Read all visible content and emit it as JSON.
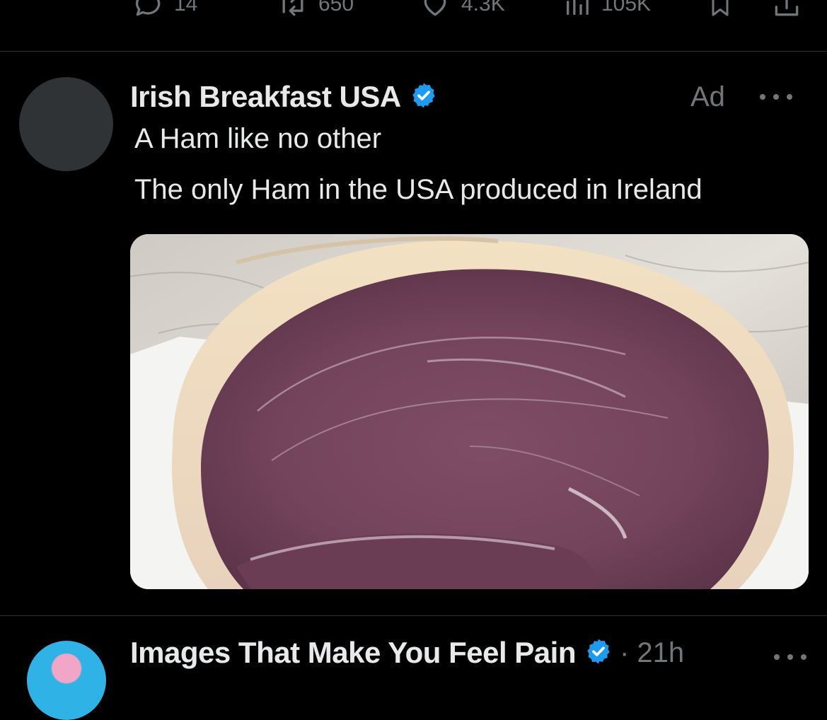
{
  "previous_tweet": {
    "actions": [
      {
        "name": "reply",
        "icon": "reply-icon",
        "count": "14"
      },
      {
        "name": "repost",
        "icon": "repost-icon",
        "count": "650"
      },
      {
        "name": "like",
        "icon": "heart-icon",
        "count": "4.3K"
      },
      {
        "name": "views",
        "icon": "analytics-icon",
        "count": "105K"
      },
      {
        "name": "bookmark",
        "icon": "bookmark-icon",
        "count": ""
      },
      {
        "name": "share",
        "icon": "share-icon",
        "count": ""
      }
    ]
  },
  "ad_tweet": {
    "author_name": "Irish Breakfast USA",
    "verified": true,
    "ad_label": "Ad",
    "more_icon": "more-options-icon",
    "lines": [
      "A Ham like no other",
      "The only Ham in the USA produced in Ireland"
    ],
    "media": {
      "icon": "ham-photo"
    }
  },
  "next_tweet": {
    "author_name": "Images That Make You Feel Pain",
    "verified": true,
    "time": "· 21h",
    "more_icon": "more-options-icon"
  },
  "colors": {
    "background": "#000000",
    "text_primary": "#e7e9ea",
    "text_secondary": "#71767b",
    "divider": "#2f3336",
    "verified_blue": "#1d9bf0"
  }
}
